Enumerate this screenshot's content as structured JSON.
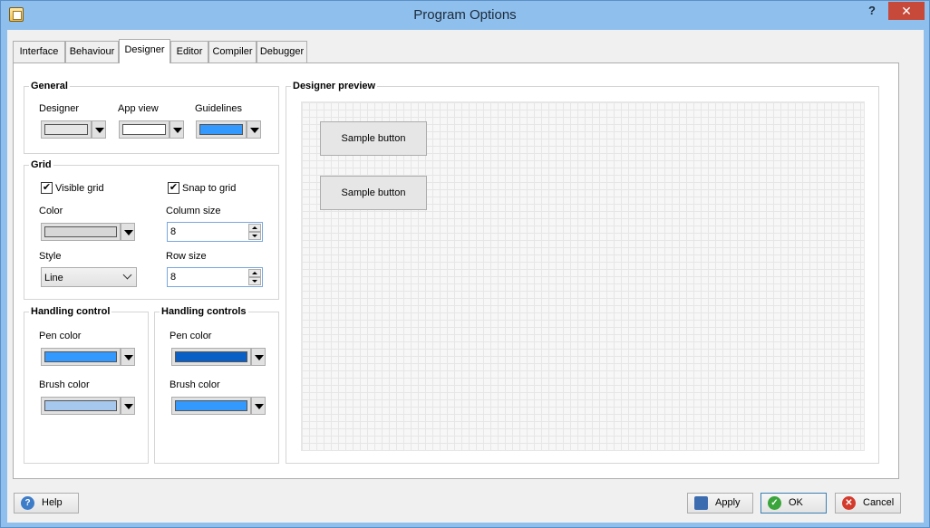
{
  "window": {
    "title": "Program Options",
    "help_glyph": "?",
    "close_glyph": "✕"
  },
  "tabs": [
    {
      "label": "Interface",
      "active": false
    },
    {
      "label": "Behaviour",
      "active": false
    },
    {
      "label": "Designer",
      "active": true
    },
    {
      "label": "Editor",
      "active": false
    },
    {
      "label": "Compiler",
      "active": false
    },
    {
      "label": "Debugger",
      "active": false
    }
  ],
  "general": {
    "title": "General",
    "designer": {
      "label": "Designer",
      "color": "#e6e6e6"
    },
    "app_view": {
      "label": "App view",
      "color": "#ffffff"
    },
    "guidelines": {
      "label": "Guidelines",
      "color": "#3399ff"
    }
  },
  "grid": {
    "title": "Grid",
    "visible_grid": {
      "label": "Visible grid",
      "checked": true,
      "mark": "✔"
    },
    "snap_to_grid": {
      "label": "Snap to grid",
      "checked": true,
      "mark": "✔"
    },
    "color": {
      "label": "Color",
      "color": "#d7d7d7"
    },
    "column_size": {
      "label": "Column size",
      "value": "8"
    },
    "style": {
      "label": "Style",
      "value": "Line"
    },
    "row_size": {
      "label": "Row size",
      "value": "8"
    }
  },
  "handling_control": {
    "title": "Handling control",
    "pen_color": {
      "label": "Pen color",
      "color": "#3399ff"
    },
    "brush_color": {
      "label": "Brush color",
      "color": "#a6c8ee"
    }
  },
  "handling_controls": {
    "title": "Handling controls",
    "pen_color": {
      "label": "Pen color",
      "color": "#0a5fc7"
    },
    "brush_color": {
      "label": "Brush color",
      "color": "#3399ff"
    }
  },
  "preview": {
    "title": "Designer preview",
    "buttons": [
      "Sample button",
      "Sample button"
    ]
  },
  "footer": {
    "help": "Help",
    "apply": "Apply",
    "ok": "OK",
    "cancel": "Cancel"
  },
  "colors": {
    "window_frame": "#8fbfec",
    "tab_panel": "#ffffff",
    "dialog_bg": "#f0f0f0"
  }
}
